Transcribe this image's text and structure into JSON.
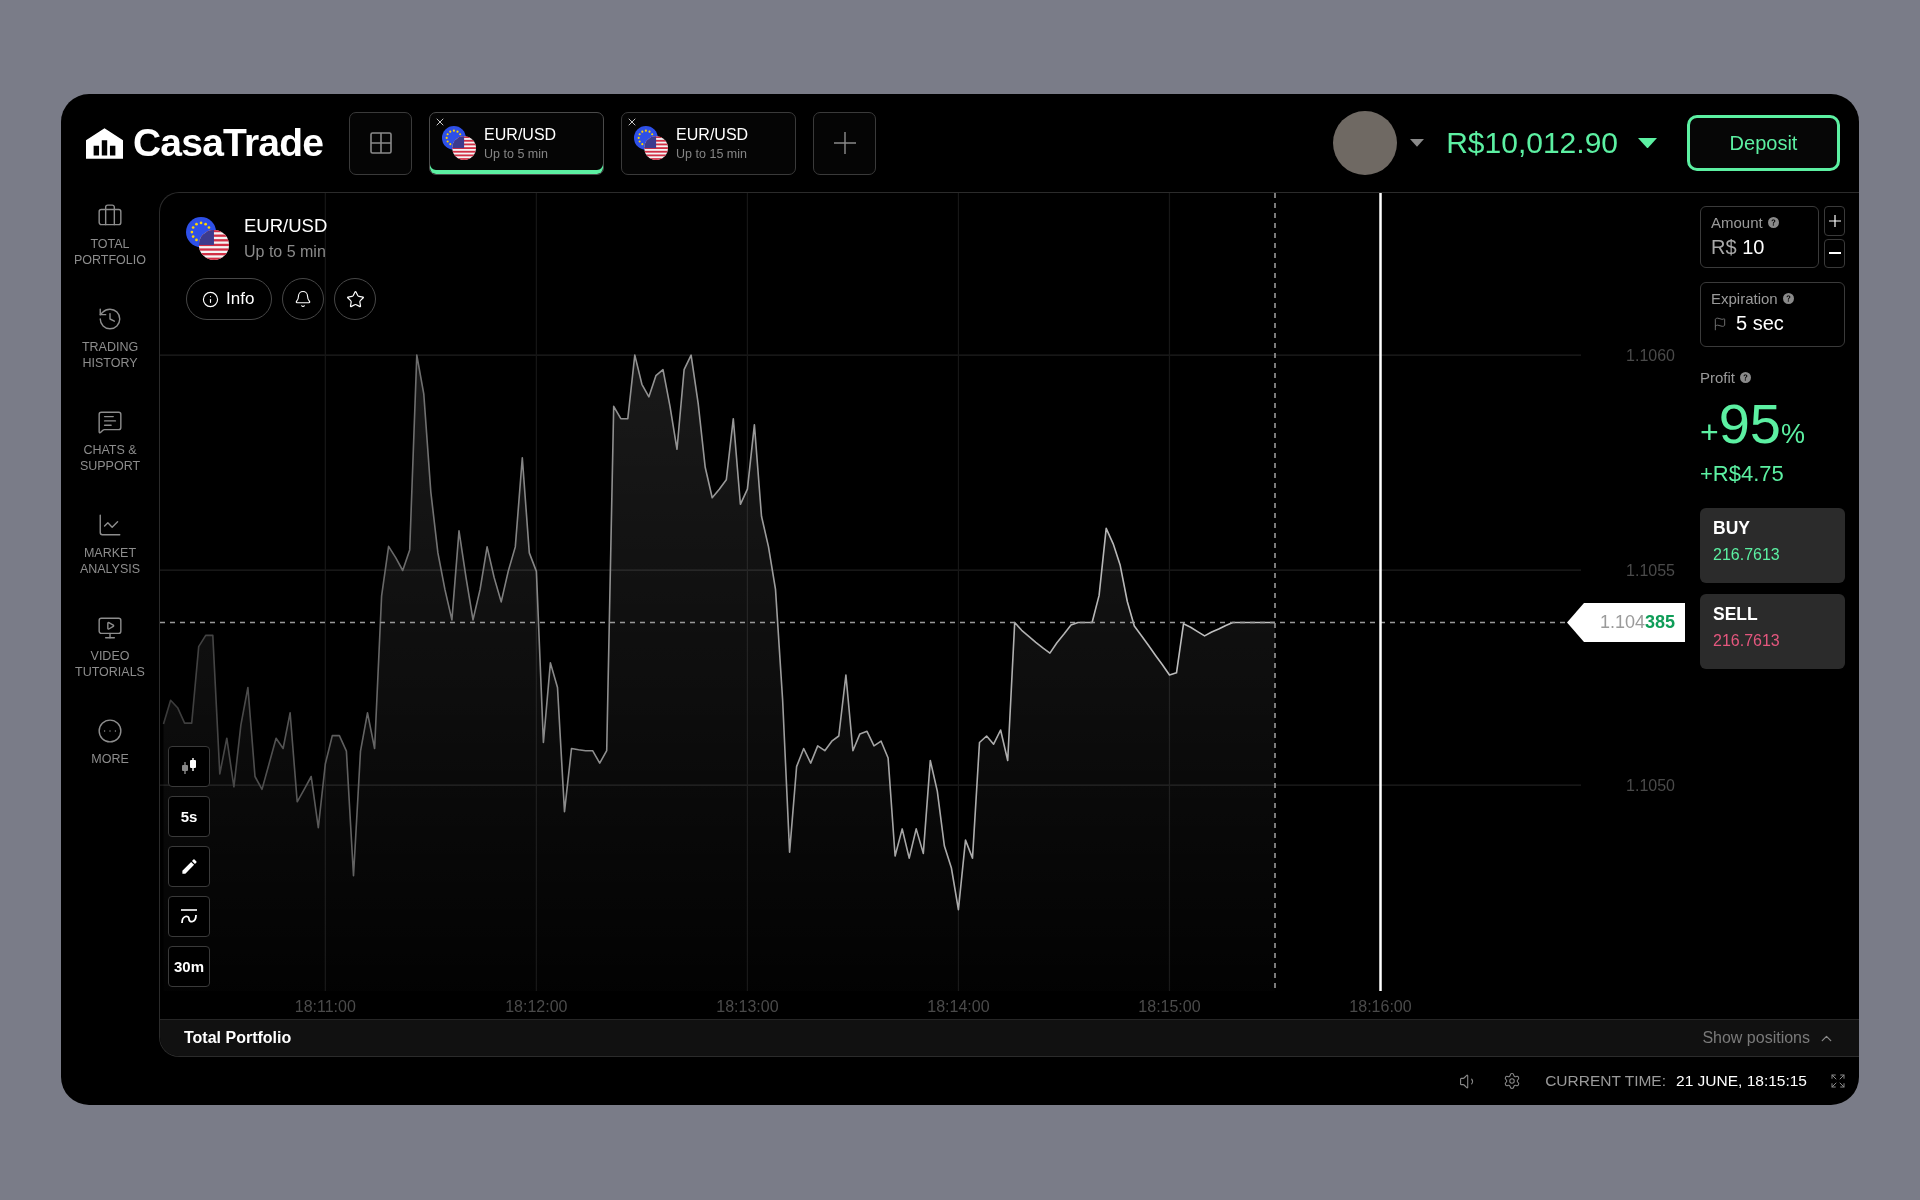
{
  "header": {
    "logo": "CasaTrade",
    "tabs": [
      {
        "pair": "EUR/USD",
        "subtitle": "Up to 5 min",
        "selected": true
      },
      {
        "pair": "EUR/USD",
        "subtitle": "Up to 15 min",
        "selected": false
      }
    ],
    "balance": "R$10,012.90",
    "deposit": "Deposit"
  },
  "sidebar": {
    "items": [
      {
        "kind": "portfolio",
        "label": "TOTAL PORTFOLIO"
      },
      {
        "kind": "history",
        "label": "TRADING HISTORY"
      },
      {
        "kind": "chat",
        "label": "CHATS & SUPPORT"
      },
      {
        "kind": "analysis",
        "label": "MARKET ANALYSIS"
      },
      {
        "kind": "video",
        "label": "VIDEO TUTORIALS"
      },
      {
        "kind": "more",
        "label": "MORE"
      }
    ]
  },
  "chart": {
    "pair": "EUR/USD",
    "subtitle": "Up to 5 min",
    "info": "Info",
    "tools": [
      {
        "kind": "chart_type"
      },
      {
        "kind": "timeframe",
        "label": "5s"
      },
      {
        "kind": "draw"
      },
      {
        "kind": "indicator"
      },
      {
        "kind": "timeframe",
        "label": "30m"
      }
    ],
    "price_tag": "1.104**385**",
    "chart_data": {
      "type": "area",
      "grid": true,
      "categories": [
        null,
        null,
        null,
        null,
        null,
        null,
        null,
        null,
        null,
        null,
        null,
        null,
        null,
        null,
        null,
        null,
        null,
        null,
        null,
        null,
        null,
        null,
        null,
        "18:11:00",
        null,
        null,
        null,
        null,
        null,
        null,
        null,
        null,
        null,
        null,
        null,
        null,
        null,
        null,
        null,
        null,
        null,
        null,
        null,
        null,
        null,
        null,
        null,
        null,
        null,
        null,
        null,
        null,
        null,
        "18:12:00",
        null,
        null,
        null,
        null,
        null,
        null,
        null,
        null,
        null,
        null,
        null,
        null,
        null,
        null,
        null,
        null,
        null,
        null,
        null,
        null,
        null,
        null,
        null,
        null,
        null,
        null,
        null,
        null,
        null,
        "18:13:00",
        null,
        null,
        null,
        null,
        null,
        null,
        null,
        null,
        null,
        null,
        null,
        null,
        null,
        null,
        null,
        null,
        null,
        null,
        null,
        null,
        null,
        null,
        null,
        null,
        null,
        null,
        null,
        null,
        null,
        "18:14:00",
        null,
        null,
        null,
        null,
        null,
        null,
        null,
        null,
        null,
        null,
        null,
        null,
        null,
        null,
        null,
        null,
        null,
        null,
        null,
        null,
        null,
        null,
        null,
        null,
        null,
        null,
        null,
        null,
        null,
        "18:15:00",
        null,
        null,
        null,
        null,
        null,
        null,
        null,
        null,
        null,
        null,
        null,
        null,
        null,
        null,
        null,
        null,
        null,
        null,
        null,
        null,
        null,
        null,
        null,
        null,
        null,
        null,
        null,
        null,
        null,
        "18:16:00",
        null,
        null,
        null,
        null,
        null,
        null,
        null,
        null,
        null,
        null,
        null,
        null,
        null,
        null,
        null,
        null,
        null,
        null,
        null,
        null,
        null,
        null,
        null,
        null,
        null,
        null,
        null,
        null
      ],
      "values": [
        1.105142,
        1.105197,
        1.10518,
        1.105144,
        1.105144,
        1.105322,
        1.105348,
        1.105348,
        1.105026,
        1.105109,
        1.104996,
        1.10514,
        1.105227,
        1.10502,
        1.10499,
        1.105049,
        1.105109,
        1.105085,
        1.105168,
        1.104961,
        1.10499,
        1.10502,
        1.104901,
        1.105049,
        1.105115,
        1.105115,
        1.105079,
        1.104789,
        1.105079,
        1.105168,
        1.105085,
        1.10544,
        1.105555,
        1.105529,
        1.105499,
        1.105547,
        1.106,
        1.105909,
        1.105682,
        1.10554,
        1.105455,
        1.105384,
        1.105591,
        1.105483,
        1.105384,
        1.105455,
        1.105554,
        1.105483,
        1.105426,
        1.105497,
        1.105554,
        1.105761,
        1.10554,
        1.105497,
        1.105099,
        1.105284,
        1.105227,
        1.104938,
        1.105085,
        1.105082,
        1.10508,
        1.10508,
        1.105051,
        1.10508,
        1.105881,
        1.105852,
        1.105852,
        1.106,
        1.105932,
        1.105903,
        1.105952,
        1.105966,
        1.105881,
        1.105781,
        1.105966,
        1.106,
        1.105887,
        1.105739,
        1.105668,
        1.105688,
        1.10571,
        1.105852,
        1.105653,
        1.105688,
        1.105838,
        1.105625,
        1.105554,
        1.105455,
        1.105199,
        1.104844,
        1.105043,
        1.105085,
        1.105051,
        1.105091,
        1.10508,
        1.105102,
        1.105114,
        1.105256,
        1.10508,
        1.105119,
        1.105125,
        1.105091,
        1.105102,
        1.105063,
        1.104835,
        1.104898,
        1.10483,
        1.104898,
        1.104841,
        1.105057,
        1.104986,
        1.104858,
        1.104807,
        1.10471,
        1.104872,
        1.10483,
        1.105099,
        1.105114,
        1.105095,
        1.105128,
        1.105057,
        1.105378,
        1.10536,
        1.105346,
        1.105332,
        1.105319,
        1.105307,
        1.105331,
        1.105351,
        1.105372,
        1.105378,
        1.105378,
        1.105378,
        1.105441,
        1.105597,
        1.105561,
        1.105511,
        1.105427,
        1.10537,
        1.105348,
        1.105325,
        1.105302,
        1.10528,
        1.105256,
        1.105261,
        1.105375,
        1.105367,
        1.105357,
        1.105347,
        1.105356,
        1.105363,
        1.105371,
        1.105378,
        1.105378,
        1.105378,
        1.105378,
        1.105378,
        1.105378,
        1.105378,
        null,
        null,
        null,
        null,
        null,
        null,
        null,
        null,
        null,
        null,
        null,
        null,
        null,
        null,
        null,
        null,
        null,
        null,
        null,
        null,
        null,
        null,
        null,
        null,
        null,
        null,
        null,
        null,
        null,
        null,
        null,
        null,
        null,
        null,
        null,
        null,
        null,
        null,
        null,
        null,
        null,
        null,
        null
      ],
      "ylim": [
        1.104521,
        1.106377
      ],
      "yticks": [
        {
          "value": 1.106,
          "label": "1.1060"
        },
        {
          "value": 1.1055,
          "label": "1.1055"
        },
        {
          "value": 1.105,
          "label": "1.1050"
        }
      ],
      "ref_lines": [
        {
          "axis": "y",
          "value": 1.105378
        },
        {
          "axis": "x",
          "value": "18:16:00"
        }
      ]
    }
  },
  "trade": {
    "amount": {
      "label": "Amount",
      "currency": "R$",
      "value": "10"
    },
    "expiration": {
      "label": "Expiration",
      "value": "5 sec"
    },
    "profit": {
      "label": "Profit",
      "sign": "+",
      "percent": "95",
      "unit": "%",
      "payout": "+R$4.75"
    },
    "buy": {
      "label": "BUY",
      "price": "216.7613"
    },
    "sell": {
      "label": "SELL",
      "price": "216.7613"
    }
  },
  "portfolio_bar": {
    "title": "Total Portfolio",
    "toggle": "Show positions"
  },
  "status_bar": {
    "time_label": "CURRENT TIME:",
    "time": "21 JUNE, 18:15:15"
  }
}
